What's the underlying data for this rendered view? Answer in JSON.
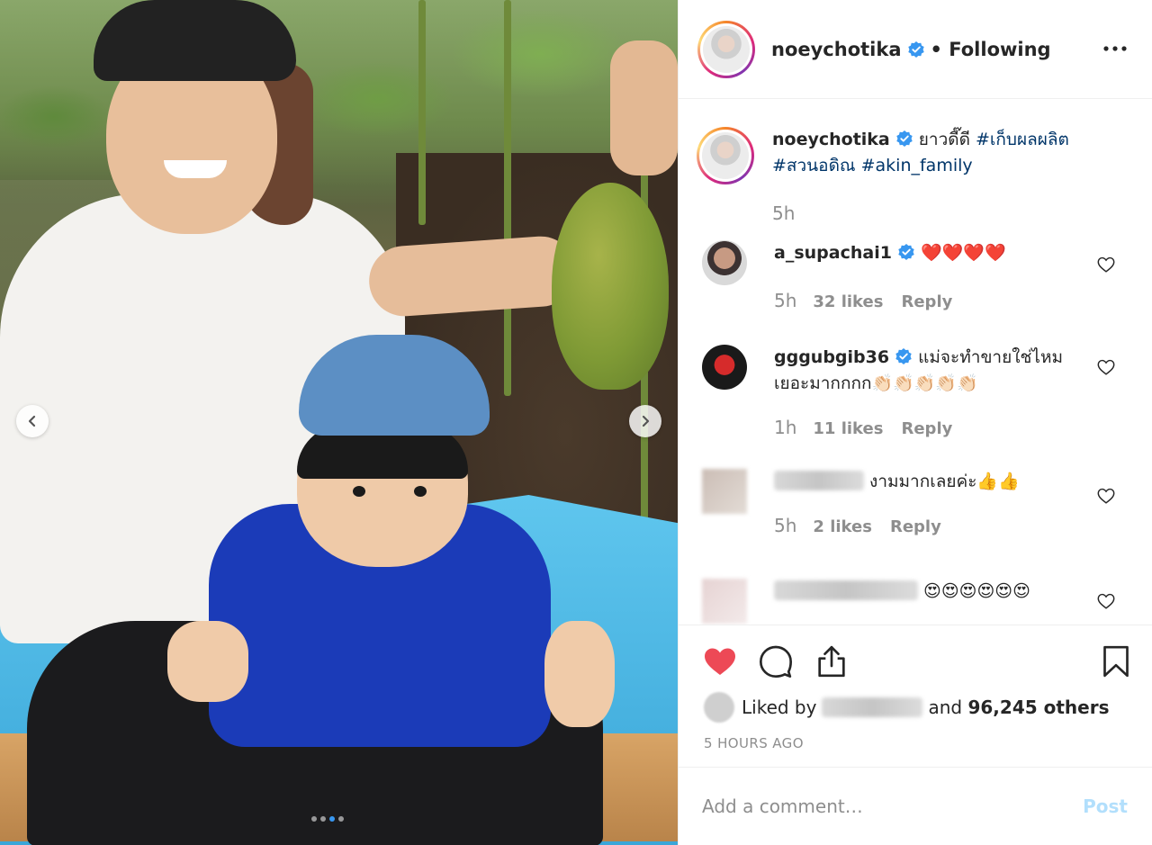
{
  "post": {
    "username": "noeychotika",
    "following_label": "• Following",
    "verified": true,
    "carousel": {
      "slide_count": 4,
      "active_index": 2
    }
  },
  "caption": {
    "username": "noeychotika",
    "text": "ยาวดี๊ดี",
    "hashtags": [
      "#เก็บผลผลิต",
      "#สวนอดิณ",
      "#akin_family"
    ],
    "time": "5h"
  },
  "comments": [
    {
      "username": "a_supachai1",
      "verified": true,
      "text": "❤️❤️❤️❤️",
      "time": "5h",
      "likes": "32 likes",
      "reply": "Reply"
    },
    {
      "username": "gggubgib36",
      "verified": true,
      "text": "แม่จะทำขายใช่ไหม เยอะมากกกก👏🏻👏🏻👏🏻👏🏻👏🏻",
      "time": "1h",
      "likes": "11 likes",
      "reply": "Reply"
    },
    {
      "username": "",
      "verified": false,
      "text": "งามมากเลยค่ะ👍👍",
      "time": "5h",
      "likes": "2 likes",
      "reply": "Reply"
    },
    {
      "username": "",
      "verified": false,
      "text": "😍😍😍😍😍😍",
      "time": "",
      "likes": "",
      "reply": ""
    }
  ],
  "likes_summary": {
    "prefix": "Liked by",
    "connector": "and",
    "others": "96,245 others"
  },
  "timestamp": "5 HOURS AGO",
  "add_comment": {
    "placeholder": "Add a comment…",
    "post_label": "Post"
  },
  "colors": {
    "verified": "#3897f0",
    "like_red": "#ed4956",
    "hashtag": "#003569",
    "post_disabled": "#b2dffc",
    "muted": "#8e8e8e"
  }
}
